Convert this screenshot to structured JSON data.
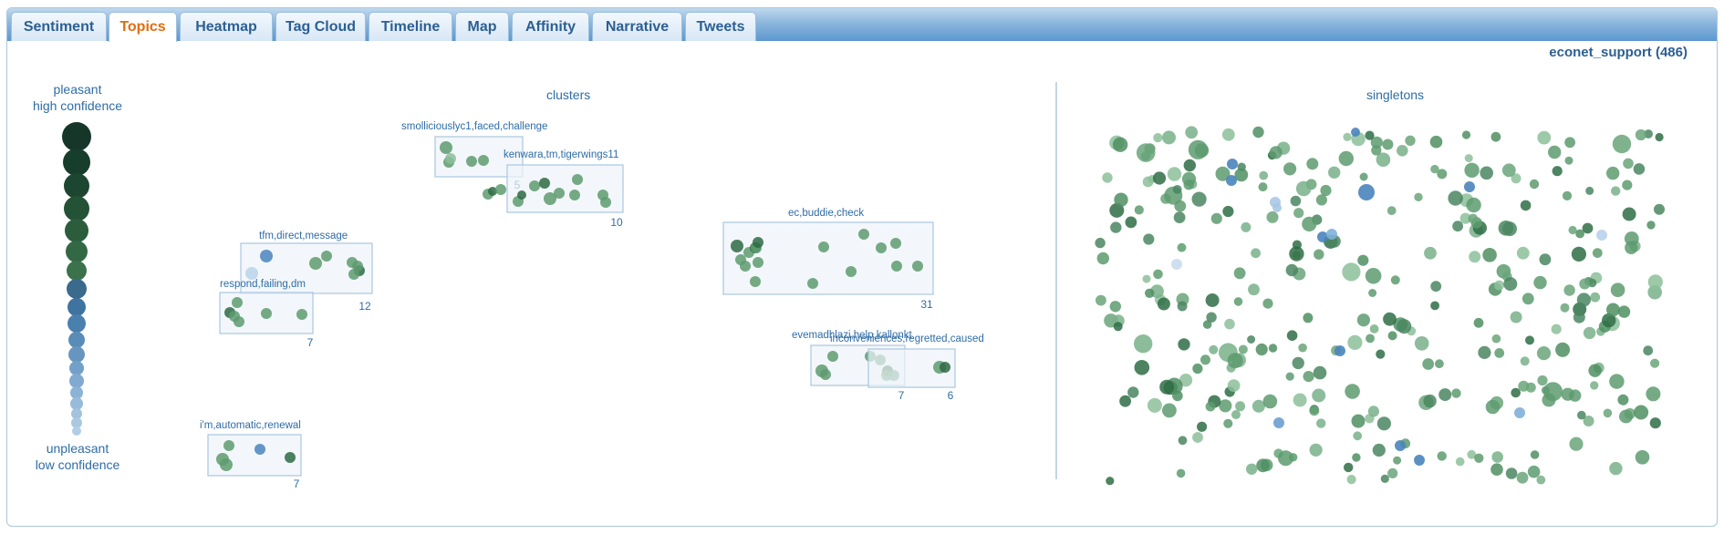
{
  "tabs": [
    {
      "label": "Sentiment",
      "active": false
    },
    {
      "label": "Topics",
      "active": true
    },
    {
      "label": "Heatmap",
      "active": false
    },
    {
      "label": "Tag Cloud",
      "active": false
    },
    {
      "label": "Timeline",
      "active": false
    },
    {
      "label": "Map",
      "active": false
    },
    {
      "label": "Affinity",
      "active": false
    },
    {
      "label": "Narrative",
      "active": false
    },
    {
      "label": "Tweets",
      "active": false
    }
  ],
  "user": {
    "name": "econet_support",
    "count": "(486)"
  },
  "legend": {
    "top_line1": "pleasant",
    "top_line2": "high confidence",
    "bottom_line1": "unpleasant",
    "bottom_line2": "low confidence"
  },
  "sections": {
    "clusters": "clusters",
    "singletons": "singletons"
  },
  "clusters": [
    {
      "label": "smolliciouslyc1,faced,challenge",
      "count": "5"
    },
    {
      "label": "kenwara,tm,tigerwings11",
      "count": "10"
    },
    {
      "label": "tfm,direct,message",
      "count": "12"
    },
    {
      "label": "respond,failing,dm",
      "count": "7"
    },
    {
      "label": "ec,buddie,check",
      "count": "31"
    },
    {
      "label": "evemadhlazi,help,kallonkt",
      "count": "7"
    },
    {
      "label": "inconveniences,regretted,caused",
      "count": "6"
    },
    {
      "label": "i'm,automatic,renewal",
      "count": "7"
    }
  ],
  "colors": {
    "accent": "#e36d0e",
    "tab_text": "#2c5f93",
    "dot_green": "#5d9b6e",
    "dot_dark": "#1f5a34",
    "dot_blue": "#3d7fc0"
  }
}
